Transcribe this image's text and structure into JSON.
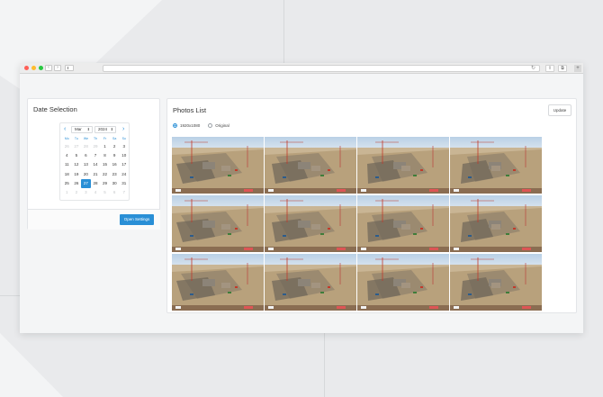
{
  "browser": {
    "back_glyph": "‹",
    "forward_glyph": "›",
    "reload_glyph": "↻",
    "share_glyph": "⇧",
    "tabs_glyph": "⧉",
    "new_tab_glyph": "+"
  },
  "date_selection": {
    "title": "Date Selection",
    "prev_glyph": "‹",
    "next_glyph": "›",
    "month": "Mar",
    "year": "2024",
    "caret": "⬍",
    "weekdays": [
      "Mo",
      "Tu",
      "We",
      "Th",
      "Fr",
      "Sa",
      "Su"
    ],
    "days": [
      {
        "d": "26",
        "muted": true
      },
      {
        "d": "27",
        "muted": true
      },
      {
        "d": "28",
        "muted": true
      },
      {
        "d": "29",
        "muted": true
      },
      {
        "d": "1"
      },
      {
        "d": "2"
      },
      {
        "d": "3"
      },
      {
        "d": "4"
      },
      {
        "d": "5"
      },
      {
        "d": "6"
      },
      {
        "d": "7"
      },
      {
        "d": "8"
      },
      {
        "d": "9"
      },
      {
        "d": "10"
      },
      {
        "d": "11"
      },
      {
        "d": "12"
      },
      {
        "d": "13"
      },
      {
        "d": "14"
      },
      {
        "d": "15"
      },
      {
        "d": "16"
      },
      {
        "d": "17"
      },
      {
        "d": "18"
      },
      {
        "d": "19"
      },
      {
        "d": "20"
      },
      {
        "d": "21"
      },
      {
        "d": "22"
      },
      {
        "d": "23"
      },
      {
        "d": "24"
      },
      {
        "d": "25"
      },
      {
        "d": "26"
      },
      {
        "d": "27",
        "selected": true
      },
      {
        "d": "28"
      },
      {
        "d": "29"
      },
      {
        "d": "30"
      },
      {
        "d": "31"
      },
      {
        "d": "1",
        "muted": true
      },
      {
        "d": "2",
        "muted": true
      },
      {
        "d": "3",
        "muted": true
      },
      {
        "d": "4",
        "muted": true
      },
      {
        "d": "5",
        "muted": true
      },
      {
        "d": "6",
        "muted": true
      },
      {
        "d": "7",
        "muted": true
      }
    ],
    "open_settings_label": "Open Settings"
  },
  "photos_list": {
    "title": "Photos List",
    "update_label": "Update",
    "resolution_options": [
      {
        "label": "1920x1080",
        "selected": true
      },
      {
        "label": "Original",
        "selected": false
      }
    ],
    "photo_count": 12
  },
  "colors": {
    "accent": "#2a8fd6",
    "background": "#e9eaec",
    "card": "#ffffff"
  }
}
